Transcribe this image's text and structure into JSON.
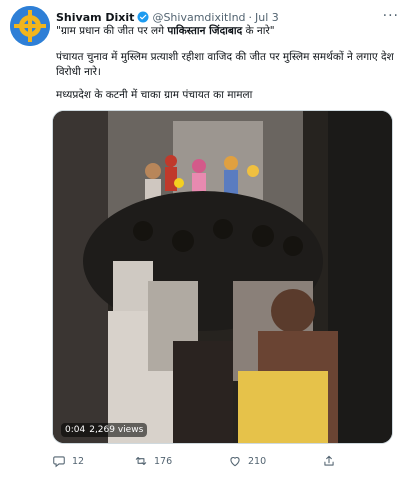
{
  "tweet": {
    "author_name": "Shivam Dixit",
    "handle": "@ShivamdixitInd",
    "separator": "·",
    "date": "Jul 3",
    "more": "···",
    "quote_open": "\"ग्राम प्रधान की जीत पर लगे ",
    "quote_bold": "पाकिस्तान जिंदाबाद",
    "quote_close": " के नारे\"",
    "para1": "पंचायत चुनाव में मुस्लिम प्रत्याशी रहीशा वाजिद की जीत पर मुस्लिम समर्थकों ने लगाए देश विरोधी नारे।",
    "para2": "मध्यप्रदेश के कटनी में चाका ग्राम पंचायत का मामला"
  },
  "video": {
    "time": "0:04",
    "views": "2,269 views"
  },
  "actions": {
    "reply_count": "12",
    "retweet_count": "176",
    "like_count": "210"
  },
  "colors": {
    "accent": "#1d9bf0",
    "text": "#0f1419",
    "muted": "#536471"
  },
  "icons": [
    "verified-badge-icon",
    "more-icon",
    "reply-icon",
    "retweet-icon",
    "like-icon",
    "share-icon"
  ]
}
